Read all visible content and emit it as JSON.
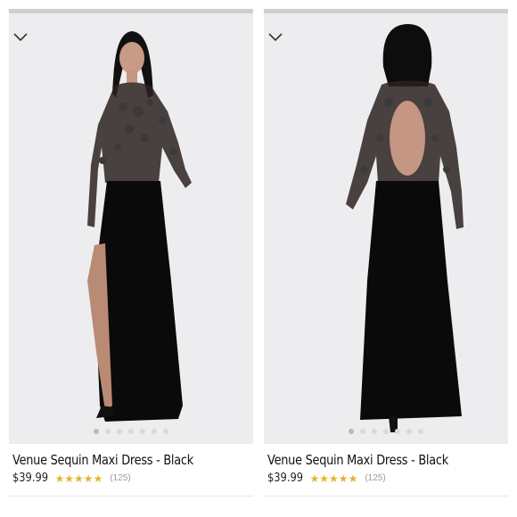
{
  "products": [
    {
      "title": "Venue Sequin Maxi Dress - Black",
      "price": "$39.99",
      "rating_stars": 5,
      "review_count": "(125)",
      "image": "front-view",
      "carousel_index": 1,
      "carousel_total": 7
    },
    {
      "title": "Venue Sequin Maxi Dress - Black",
      "price": "$39.99",
      "rating_stars": 5,
      "review_count": "(125)",
      "image": "back-view",
      "carousel_index": 1,
      "carousel_total": 7
    }
  ],
  "icons": {
    "collapse": "chevron-down-icon",
    "rating": "star-icon"
  },
  "colors": {
    "star": "#e5b52c",
    "photo_bg": "#ededef",
    "dress": "#0a0a0a"
  }
}
